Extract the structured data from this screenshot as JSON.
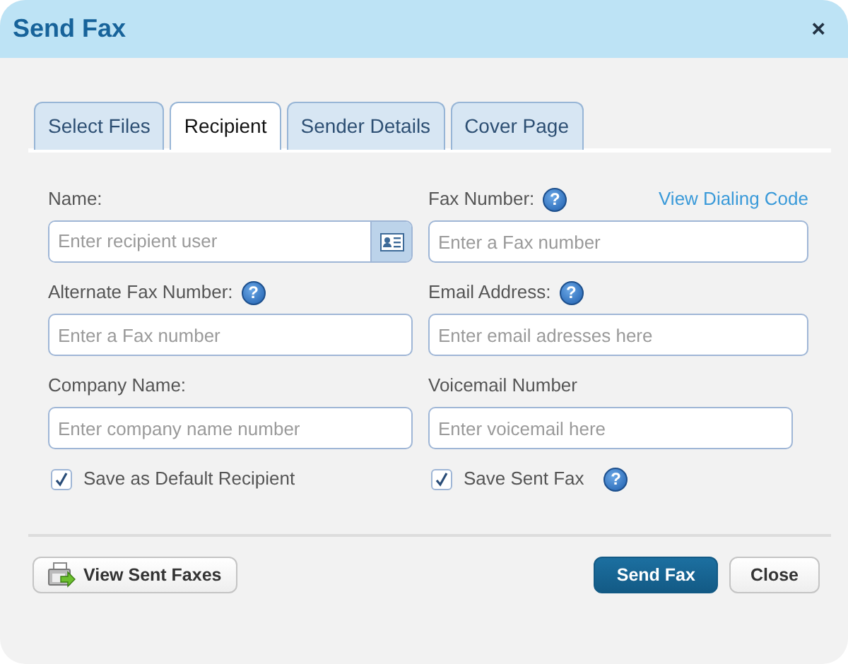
{
  "window": {
    "title": "Send Fax",
    "close": "×"
  },
  "tabs": [
    {
      "label": "Select Files",
      "selected": false
    },
    {
      "label": "Recipient",
      "selected": true
    },
    {
      "label": "Sender Details",
      "selected": false
    },
    {
      "label": "Cover Page",
      "selected": false
    }
  ],
  "fields": [
    {
      "label": "Name:",
      "placeholder": "Enter recipient user",
      "kind": "lookup"
    },
    {
      "label": "Fax Number:",
      "placeholder": "Enter a Fax number",
      "help": "?",
      "link": "View Dialing Code",
      "kind": "plain"
    },
    {
      "label": "Alternate Fax Number:",
      "placeholder": "Enter a Fax number",
      "help": "?",
      "kind": "plain"
    },
    {
      "label": "Email Address:",
      "placeholder": "Enter email adresses here",
      "help": "?",
      "kind": "plain"
    },
    {
      "label": "Company Name:",
      "placeholder": "Enter company name number",
      "kind": "plain"
    },
    {
      "label": "Voicemail Number",
      "placeholder": "Enter voicemail here",
      "kind": "short"
    }
  ],
  "checkboxes": [
    {
      "label": "Save as Default Recipient",
      "checked": true
    },
    {
      "label": "Save Sent Fax",
      "checked": true,
      "help": "?"
    }
  ],
  "footer": {
    "view_sent": "View Sent Faxes",
    "send": "Send Fax",
    "close": "Close"
  }
}
